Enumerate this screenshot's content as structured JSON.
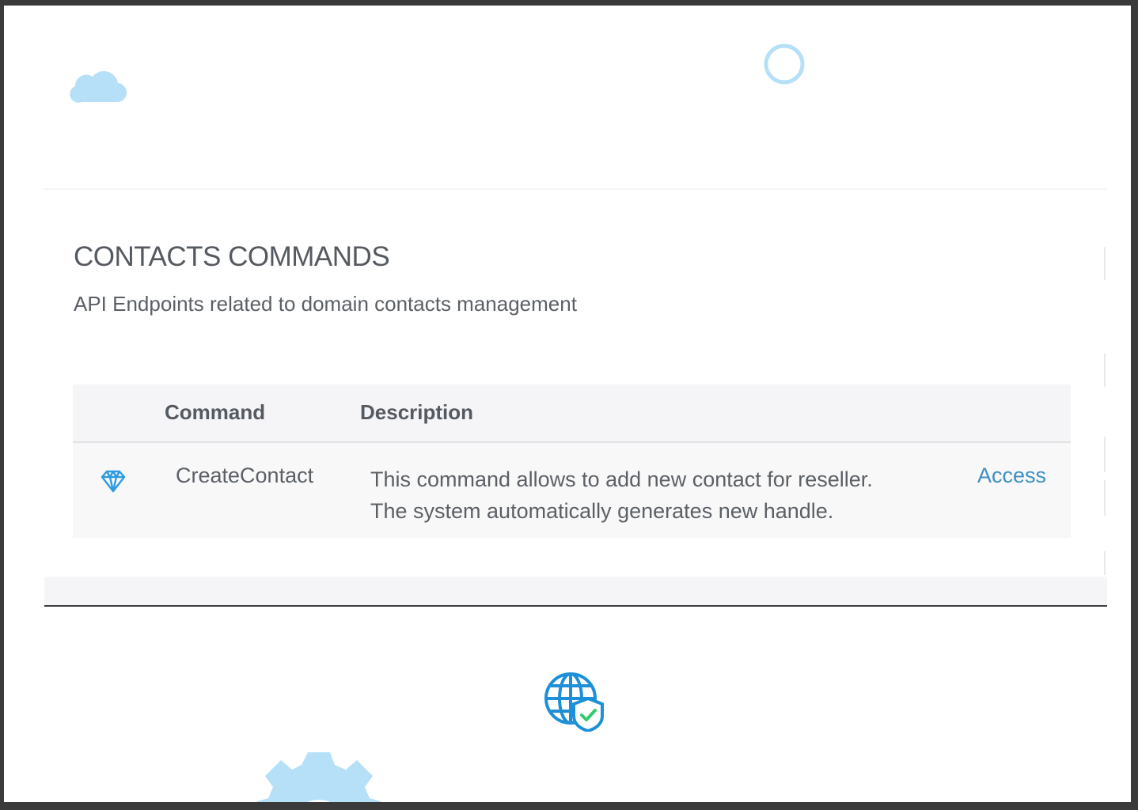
{
  "section": {
    "title": "CONTACTS COMMANDS",
    "subtitle": "API Endpoints related to domain contacts management"
  },
  "table": {
    "headers": {
      "command": "Command",
      "description": "Description"
    },
    "rows": [
      {
        "icon": "diamond-icon",
        "command": "CreateContact",
        "description_lines": [
          "This command allows to add new contact for reseller.",
          "The system automatically generates new handle."
        ],
        "action": "Access"
      }
    ]
  },
  "decorations": {
    "cloud": "cloud-icon",
    "circle": "circle-icon",
    "gear": "gear-icon",
    "globe": "globe-shield-check-icon"
  },
  "colors": {
    "accent": "#3d8fc4",
    "decor_light_blue": "#b5e0f8",
    "shield_green": "#2ecc71",
    "globe_blue": "#1e90d8"
  }
}
